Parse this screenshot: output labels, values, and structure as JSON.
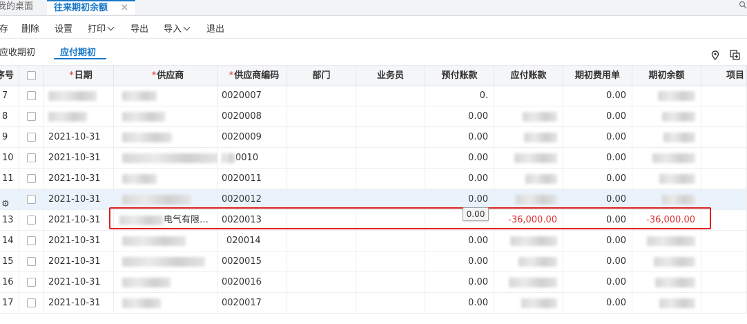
{
  "tabs": {
    "home_label": "我的桌面",
    "active_label": "往来期初余额",
    "close_symbol": "✕"
  },
  "toolbar": {
    "save_label": "存",
    "delete_label": "删除",
    "settings_label": "设置",
    "print_label": "打印",
    "export_label": "导出",
    "import_label": "导入",
    "exit_label": "退出"
  },
  "subtabs": {
    "receivable_label": "应收期初",
    "payable_label": "应付期初"
  },
  "table": {
    "headers": {
      "num": "序号",
      "date": "日期",
      "supplier": "供应商",
      "code": "供应商编码",
      "dept": "部门",
      "salesperson": "业务员",
      "prepaid": "预付账款",
      "payable": "应付账款",
      "fee": "期初费用单",
      "balance": "期初余额",
      "project": "项目"
    },
    "required_mark": "*",
    "rows": [
      {
        "num": "7",
        "date": "",
        "supplier": "",
        "code": "0020007",
        "prepaid": "0.",
        "payable": "",
        "fee": "0.00",
        "balance": ""
      },
      {
        "num": "8",
        "date": "",
        "supplier": "",
        "code": "0020008",
        "prepaid": "0.00",
        "payable": "",
        "fee": "0.00",
        "balance": ""
      },
      {
        "num": "9",
        "date": "2021-10-31",
        "supplier": "",
        "code": "0020009",
        "prepaid": "0.00",
        "payable": "",
        "fee": "0.00",
        "balance": ""
      },
      {
        "num": "10",
        "date": "2021-10-31",
        "supplier": "",
        "code": "0010",
        "prepaid": "0.00",
        "payable": "",
        "fee": "0.00",
        "balance": ""
      },
      {
        "num": "11",
        "date": "2021-10-31",
        "supplier": "",
        "code": "0020011",
        "prepaid": "0.00",
        "payable": "",
        "fee": "0.00",
        "balance": ""
      },
      {
        "num": "",
        "date": "2021-10-31",
        "supplier": "",
        "code": "0020012",
        "prepaid": "0.00",
        "payable": "",
        "fee": "0.00",
        "balance": ""
      },
      {
        "num": "13",
        "date": "2021-10-31",
        "supplier": "电气有限…",
        "code": "0020013",
        "prepaid": "",
        "payable": "-36,000.00",
        "fee": "0.00",
        "balance": "-36,000.00"
      },
      {
        "num": "14",
        "date": "2021-10-31",
        "supplier": "",
        "code": "020014",
        "prepaid": "0.00",
        "payable": "",
        "fee": "0.00",
        "balance": ""
      },
      {
        "num": "15",
        "date": "2021-10-31",
        "supplier": "",
        "code": "0020015",
        "prepaid": "0.00",
        "payable": "",
        "fee": "0.00",
        "balance": ""
      },
      {
        "num": "16",
        "date": "2021-10-31",
        "supplier": "",
        "code": "0020016",
        "prepaid": "0.00",
        "payable": "",
        "fee": "0.00",
        "balance": ""
      },
      {
        "num": "17",
        "date": "2021-10-31",
        "supplier": "",
        "code": "0020017",
        "prepaid": "0.00",
        "payable": "",
        "fee": "0.00",
        "balance": ""
      }
    ],
    "editing_cell_value": "0.00"
  },
  "colors": {
    "accent": "#1677c8",
    "negative": "#e03030",
    "highlight_box": "#e02020",
    "selected_row": "#eaf3fc"
  }
}
